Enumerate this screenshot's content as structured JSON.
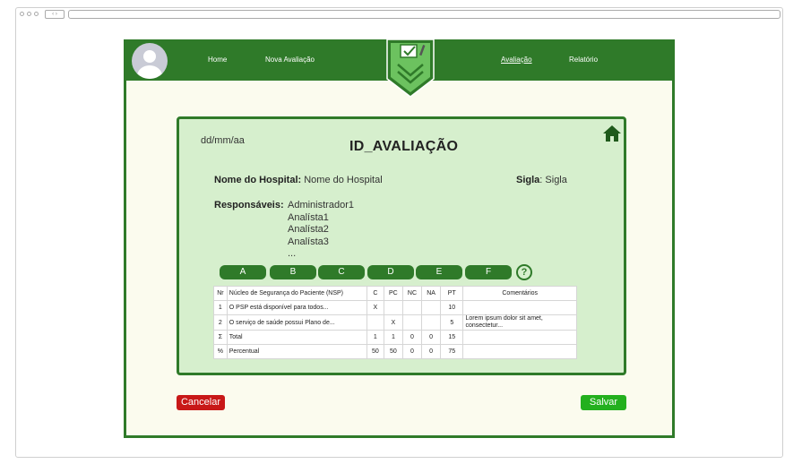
{
  "browser": {
    "nav_glyph": "‹ ›"
  },
  "nav": {
    "home": "Home",
    "nova_avaliacao": "Nova Avaliação",
    "avaliacao": "Avaliação",
    "relatorio": "Relatório"
  },
  "colors": {
    "primary": "#2f7a29",
    "card": "#d6efcd",
    "background": "#fbfbee",
    "cancel": "#c81818",
    "save": "#23b01e"
  },
  "evaluation": {
    "date": "dd/mm/aa",
    "title": "ID_AVALIAÇÃO",
    "hospital_label": "Nome do Hospital:",
    "hospital_value": "Nome do Hospital",
    "sigla_label": "Sigla",
    "sigla_value": ": Sigla",
    "responsaveis_label": "Responsáveis:",
    "responsaveis": [
      "Administrador1",
      "Analísta1",
      "Analísta2",
      "Analísta3",
      "..."
    ],
    "tabs": [
      "A",
      "B",
      "C",
      "D",
      "E",
      "F"
    ],
    "help": "?"
  },
  "table": {
    "headers": [
      "Nr",
      "Núcleo de Segurança do Paciente (NSP)",
      "C",
      "PC",
      "NC",
      "NA",
      "PT",
      "Comentários"
    ],
    "rows": [
      [
        "1",
        "O PSP está disponível para todos...",
        "X",
        "",
        "",
        "",
        "10",
        ""
      ],
      [
        "2",
        "O serviço de saúde possui Plano de...",
        "",
        "X",
        "",
        "",
        "5",
        "Lorem ipsum dolor sit amet, consectetur..."
      ],
      [
        "Σ",
        "Total",
        "1",
        "1",
        "0",
        "0",
        "15",
        ""
      ],
      [
        "%",
        "Percentual",
        "50",
        "50",
        "0",
        "0",
        "75",
        ""
      ]
    ]
  },
  "actions": {
    "cancel": "Cancelar",
    "save": "Salvar"
  }
}
